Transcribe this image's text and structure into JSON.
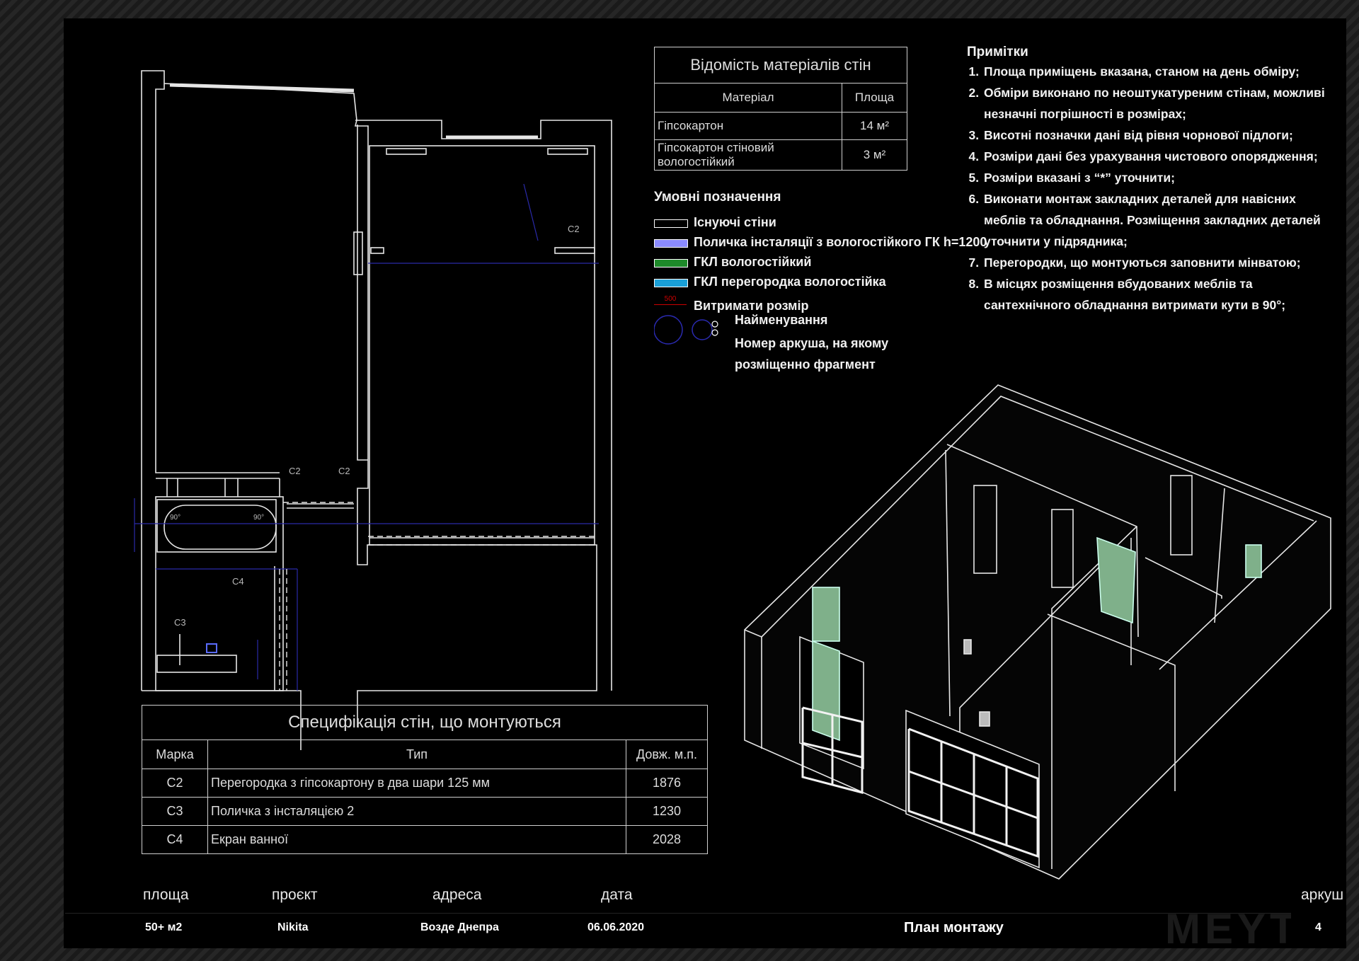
{
  "materials_table": {
    "title": "Відомість матеріалів стін",
    "headers": [
      "Матеріал",
      "Площа"
    ],
    "rows": [
      {
        "material": "Гіпсокартон",
        "area": "14 м²"
      },
      {
        "material": "Гіпсокартон стіновий вологостійкий",
        "area": "3 м²"
      }
    ]
  },
  "notes": {
    "title": "Примітки",
    "items": [
      "Площа приміщень вказана, станом на день обміру;",
      "Обміри виконано по неоштукатуреним стінам, можливі незначні погрішності в розмірах;",
      "Висотні позначки дані від рівня чорнової підлоги;",
      "Розміри дані без урахування чистового опорядження;",
      "Розміри вказані з “*” уточнити;",
      "Виконати монтаж закладних деталей для навісних меблів та обладнання. Розміщення закладних деталей уточнити у підрядника;",
      "Перегородки, що монтуються заповнити мінватою;",
      "В місцях розміщення вбудованих меблів та сантехнічного обладнання витримати кути в 90°;"
    ]
  },
  "legend": {
    "title": "Умовні позначення",
    "items": [
      {
        "label": "Існуючі стіни",
        "color": "#000000"
      },
      {
        "label": "Поличка інсталяції з вологостійкого ГК h=1200",
        "color": "#8b8bff"
      },
      {
        "label": "ГКЛ вологостійкий",
        "color": "#1e8a2a"
      },
      {
        "label": "ГКЛ перегородка вологостійка",
        "color": "#1aa0d8"
      },
      {
        "label": "Витримати розмір",
        "color": "#cc0000",
        "sample": "500"
      },
      {
        "label": "Найменування"
      },
      {
        "label": "Номер аркуша, на якому розміщенно фрагмент"
      }
    ]
  },
  "spec_table": {
    "title": "Специфікація стін, що монтуються",
    "headers": [
      "Марка",
      "Тип",
      "Довж. м.п."
    ],
    "rows": [
      {
        "mark": "С2",
        "type": "Перегородка з гіпсокартону в два шари 125 мм",
        "length": "1876"
      },
      {
        "mark": "С3",
        "type": "Поличка з інсталяцією 2",
        "length": "1230"
      },
      {
        "mark": "С4",
        "type": "Екран ванної",
        "length": "2028"
      }
    ]
  },
  "plan_labels": {
    "c2_a": "С2",
    "c2_b": "С2",
    "c2_c": "С2",
    "c3": "С3",
    "c4": "С4",
    "deg_a": "90°",
    "deg_b": "90°"
  },
  "footer": {
    "area_label": "площа",
    "area_value": "50+ м2",
    "project_label": "проєкт",
    "project_value": "Nikita",
    "address_label": "адреса",
    "address_value": "Возде Днепра",
    "date_label": "дата",
    "date_value": "06.06.2020",
    "sheet_title": "План монтажу",
    "sheet_label": "аркуш",
    "sheet_value": "4",
    "logo": "MEYT"
  }
}
